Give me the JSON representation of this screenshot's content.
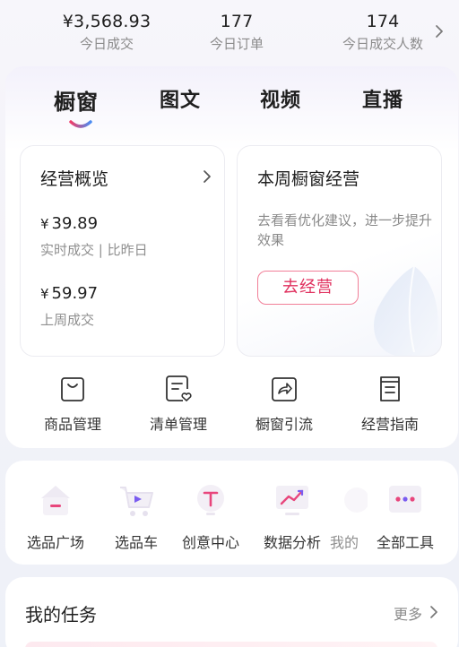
{
  "stats": [
    {
      "value": "¥3,568.93",
      "label": "今日成交"
    },
    {
      "value": "177",
      "label": "今日订单"
    },
    {
      "value": "174",
      "label": "今日成交人数"
    }
  ],
  "tabs": [
    "橱窗",
    "图文",
    "视频",
    "直播"
  ],
  "overview": {
    "title": "经营概览",
    "items": [
      {
        "currency": "¥",
        "amount": "39.89",
        "label": "实时成交 | 比昨日"
      },
      {
        "currency": "¥",
        "amount": "59.97",
        "label": "上周成交"
      }
    ]
  },
  "weekly": {
    "title": "本周橱窗经营",
    "description": "去看看优化建议，进一步提升效果",
    "button_label": "去经营"
  },
  "quick_actions": [
    {
      "label": "商品管理",
      "icon": "bag-icon"
    },
    {
      "label": "清单管理",
      "icon": "list-heart-icon"
    },
    {
      "label": "橱窗引流",
      "icon": "share-icon"
    },
    {
      "label": "经营指南",
      "icon": "guide-book-icon"
    }
  ],
  "tools": [
    {
      "label": "选品广场",
      "icon": "store-icon"
    },
    {
      "label": "选品车",
      "icon": "cart-icon"
    },
    {
      "label": "创意中心",
      "icon": "creative-icon"
    },
    {
      "label": "数据分析",
      "icon": "chart-icon"
    },
    {
      "label": "我的",
      "icon": "profile-icon"
    },
    {
      "label": "全部工具",
      "icon": "all-tools-icon"
    }
  ],
  "tasks": {
    "title": "我的任务",
    "more_label": "更多"
  },
  "colors": {
    "accent": "#e0305e",
    "accent_border": "#f17f98",
    "text_primary": "#1f1f1f",
    "text_secondary": "#8a8a8a"
  }
}
